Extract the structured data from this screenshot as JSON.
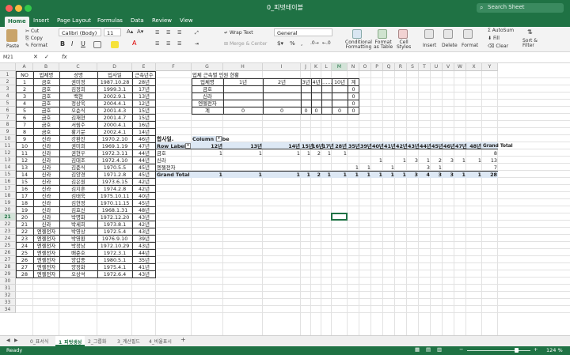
{
  "window": {
    "title": "0_피벗테이블",
    "search_placeholder": "Search Sheet"
  },
  "ribbon_tabs": [
    "Home",
    "Insert",
    "Page Layout",
    "Formulas",
    "Data",
    "Review",
    "View"
  ],
  "ribbon": {
    "paste": "Paste",
    "cut": "Cut",
    "copy": "Copy",
    "format": "Format",
    "font_name": "Calibri (Body)",
    "font_size": "11",
    "wrap_text": "Wrap Text",
    "merge_center": "Merge & Center",
    "number_format": "General",
    "percent": "%",
    "comma": ",",
    "conditional_formatting": "Conditional\nFormatting",
    "format_as_table": "Format\nas Table",
    "cell_styles": "Cell\nStyles",
    "insert": "Insert",
    "delete": "Delete",
    "format_cells": "Format",
    "autosum": "AutoSum",
    "fill": "Fill",
    "clear": "Clear",
    "sort_filter": "Sort &\nFilter"
  },
  "formula_bar": {
    "name_box": "M21",
    "fx": "fx",
    "content": ""
  },
  "columns": [
    "A",
    "B",
    "C",
    "D",
    "E",
    "F",
    "G",
    "H",
    "I",
    "J",
    "K",
    "L",
    "M",
    "N",
    "O",
    "P",
    "Q",
    "R",
    "S",
    "T",
    "U",
    "V",
    "W",
    "X",
    "Y"
  ],
  "active_column": "M",
  "active_row": 21,
  "rows": [
    1,
    2,
    3,
    4,
    5,
    6,
    7,
    8,
    9,
    10,
    11,
    12,
    13,
    14,
    15,
    16,
    17,
    18,
    19,
    20,
    21,
    22,
    23,
    24,
    25,
    26,
    27,
    28,
    29,
    30,
    31,
    32,
    33,
    34
  ],
  "employee_table": {
    "headers": [
      "NO",
      "업체명",
      "성명",
      "입사일",
      "근속년수"
    ],
    "rows": [
      [
        "1",
        "금호",
        "권미정",
        "1987.10.28",
        "28년"
      ],
      [
        "2",
        "금호",
        "김정희",
        "1999.3.1",
        "17년"
      ],
      [
        "3",
        "금호",
        "백현",
        "2002.9.1",
        "13년"
      ],
      [
        "4",
        "금호",
        "정상욱",
        "2004.4.1",
        "12년"
      ],
      [
        "5",
        "금호",
        "오순식",
        "2001.4.3",
        "15년"
      ],
      [
        "6",
        "금호",
        "김재현",
        "2001.4.7",
        "15년"
      ],
      [
        "7",
        "금호",
        "서림주",
        "2000.4.1",
        "16년"
      ],
      [
        "8",
        "금호",
        "황기문",
        "2002.4.1",
        "14년"
      ],
      [
        "9",
        "신라",
        "강환찬",
        "1970.2.10",
        "46년"
      ],
      [
        "10",
        "신라",
        "권미희",
        "1969.1.19",
        "47년"
      ],
      [
        "11",
        "신라",
        "권현우",
        "1972.3.11",
        "44년"
      ],
      [
        "12",
        "신라",
        "김대조",
        "1972.4.10",
        "44년"
      ],
      [
        "13",
        "신라",
        "김준식",
        "1970.5.5",
        "45년"
      ],
      [
        "14",
        "신라",
        "김양경",
        "1971.2.8",
        "45년"
      ],
      [
        "15",
        "신라",
        "김은원",
        "1973.6.15",
        "42년"
      ],
      [
        "16",
        "신라",
        "김지훈",
        "1974.2.8",
        "42년"
      ],
      [
        "17",
        "신라",
        "김태욱",
        "1975.10.11",
        "40년"
      ],
      [
        "18",
        "신라",
        "김현정",
        "1970.11.15",
        "45년"
      ],
      [
        "19",
        "신라",
        "김효신",
        "1968.1.31",
        "48년"
      ],
      [
        "20",
        "신라",
        "박명화",
        "1972.12.20",
        "43년"
      ],
      [
        "21",
        "신라",
        "박세희",
        "1973.8.1",
        "42년"
      ],
      [
        "22",
        "엔젤전자",
        "박영상",
        "1972.5.4",
        "43년"
      ],
      [
        "23",
        "엔젤전자",
        "박영환",
        "1976.9.10",
        "39년"
      ],
      [
        "24",
        "엔젤전자",
        "박정남",
        "1972.10.29",
        "43년"
      ],
      [
        "25",
        "엔젤전자",
        "배준호",
        "1972.3.1",
        "44년"
      ],
      [
        "26",
        "엔젤전자",
        "양갑종",
        "1980.5.1",
        "35년"
      ],
      [
        "27",
        "엔젤전자",
        "양정화",
        "1975.4.1",
        "41년"
      ],
      [
        "28",
        "엔젤전자",
        "오상석",
        "1972.6.4",
        "43년"
      ]
    ]
  },
  "summary_table": {
    "title": "업체 근속별 인원 현황",
    "headers": [
      "업체명",
      "1년",
      "2년",
      "3년",
      "4년",
      "……",
      "10년",
      "계"
    ],
    "rows": [
      [
        "금호",
        "",
        "",
        "",
        "",
        "",
        "",
        "0"
      ],
      [
        "신라",
        "",
        "",
        "",
        "",
        "",
        "",
        "0"
      ],
      [
        "엔젤전자",
        "",
        "",
        "",
        "",
        "",
        "",
        "0"
      ]
    ],
    "total_row": [
      "계",
      "0",
      "0",
      "0",
      "0",
      "",
      "0",
      "0"
    ]
  },
  "pivot": {
    "corner_label": "합사일.",
    "column_labels": "Column Labe",
    "row_labels": "Row Labels",
    "columns": [
      "12년",
      "13년",
      "14년",
      "15년",
      "16년",
      "17년",
      "28년",
      "35년",
      "39년",
      "40년",
      "41년",
      "42년",
      "43년",
      "44년",
      "45년",
      "46년",
      "47년",
      "48년"
    ],
    "grand_total_label": "Grand Total",
    "rows": [
      {
        "label": "금호",
        "values": [
          "1",
          "1",
          "1",
          "1",
          "2",
          "1",
          "1",
          "",
          "",
          "",
          "",
          "",
          "",
          "",
          "",
          "",
          "",
          ""
        ],
        "total": "8"
      },
      {
        "label": "신라",
        "values": [
          "",
          "",
          "",
          "",
          "",
          "",
          "",
          "",
          "",
          "1",
          "",
          "1",
          "3",
          "1",
          "2",
          "3",
          "1",
          "1"
        ],
        "total": "13"
      },
      {
        "label": "엔젤전자",
        "values": [
          "",
          "",
          "",
          "",
          "",
          "",
          "",
          "1",
          "1",
          "",
          "1",
          "",
          "",
          "3",
          "1",
          "",
          "",
          ""
        ],
        "total": "7"
      }
    ],
    "grand_total": {
      "label": "Grand Total",
      "values": [
        "1",
        "1",
        "1",
        "1",
        "2",
        "1",
        "1",
        "1",
        "1",
        "1",
        "1",
        "1",
        "3",
        "4",
        "3",
        "3",
        "1",
        "1"
      ],
      "total": "28"
    }
  },
  "sheet_tabs": [
    "0_표서식",
    "1_피벗생성",
    "2_그룹화",
    "3_계산필드",
    "4_비율표시"
  ],
  "active_sheet": "1_피벗생성",
  "status": {
    "ready": "Ready",
    "zoom": "124 %"
  },
  "colors": {
    "excel_green": "#1f7244",
    "pivot_header": "#dde8f4"
  }
}
